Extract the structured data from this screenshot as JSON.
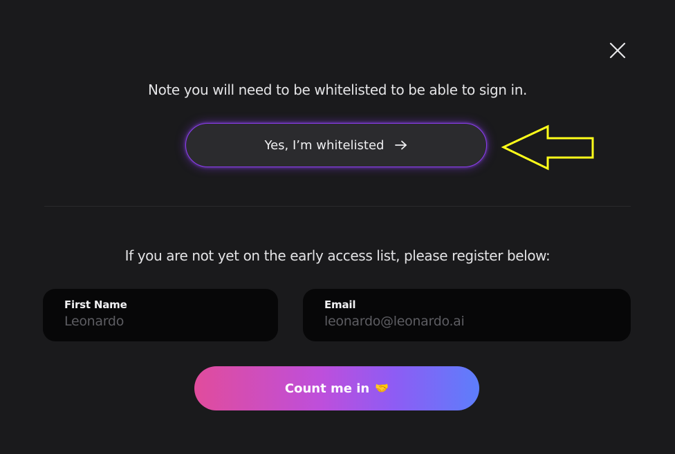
{
  "dialog": {
    "close_icon": "close-icon",
    "note": "Note you will need to be whitelisted to be able to sign in.",
    "whitelist_button": {
      "label": "Yes, I’m whitelisted",
      "icon": "arrow-right-icon"
    },
    "annotation": {
      "icon": "annotation-arrow-icon",
      "color": "#ffff1a"
    },
    "register_note": "If you are not yet on the early access list, please register below:",
    "first_name": {
      "label": "First Name",
      "placeholder": "Leonardo",
      "value": ""
    },
    "email": {
      "label": "Email",
      "placeholder": "leonardo@leonardo.ai",
      "value": ""
    },
    "submit_button": {
      "label": "Count me in",
      "emoji": "🤝"
    },
    "colors": {
      "background": "#1a1a1c",
      "whitelist_border": "#8b3cf0",
      "gradient_start": "#e14c9c",
      "gradient_end": "#5d7efb"
    }
  }
}
